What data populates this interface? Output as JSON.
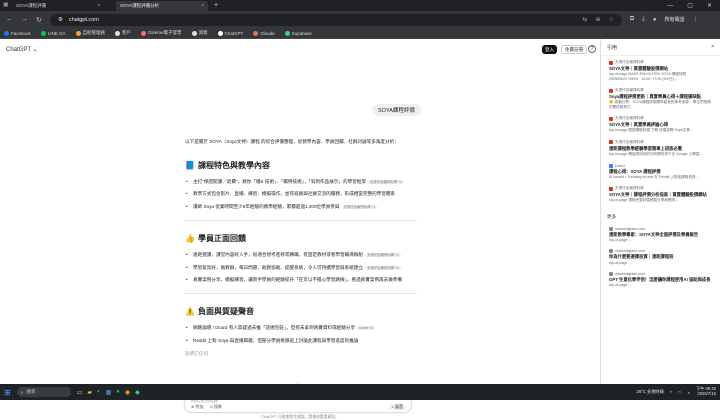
{
  "browser": {
    "tabs": [
      {
        "label": "SOYA課程評價"
      },
      {
        "label": "SOYA課程評價分析"
      }
    ],
    "url": "chatgpt.com",
    "account_label": "所有電話",
    "bookmarks": [
      "Facebook",
      "LINE OA",
      "自助管理員",
      "客戶",
      "Giveme電子發票",
      "測資",
      "ChatGPT",
      "Claude",
      "Supabase"
    ],
    "bookmark_colors": [
      "#1877f2",
      "#06c755",
      "#f5a623",
      "#e0e0e0",
      "#ff6b6b",
      "#e0e0e0",
      "#ffffff",
      "#d97757",
      "#3ecf8e"
    ]
  },
  "header": {
    "title": "ChatGPT ⌄",
    "login_label": "登入",
    "signup_label": "免費註冊",
    "help_icon": "?"
  },
  "user_message": "SOYA課程評價",
  "answer": {
    "intro": "以下是關於 SOYA（Soya文神）課程 的綜合評價整理，從教學內容、學員回饋、社群討論等多角度分析：",
    "sections": [
      {
        "icon": "📘",
        "title": "課程特色與教學內容",
        "items": [
          {
            "text": "主打\"保證開課／退費\"，教你「穩K 技術」、「獨特技術」，「寫到作品展示」的學習框架",
            "src": "天書仔店報資料庫 +1"
          },
          {
            "text": "教學方式包含影片、直播、練習、模擬操作，並有班群與社群交流的服務，形成相當完整的學習體系",
            "src": ""
          },
          {
            "text": "講師 Soya 從業時間至少6年經驗的教學經驗，累積超過1,200位學員參與",
            "src": "天書仔店報資料庫 +1"
          }
        ]
      },
      {
        "icon": "👍",
        "title": "學員正面回饋",
        "items": [
          {
            "text": "遠距授課，課堂內容好入手，很適合想考進修或轉職，有固定教材或者學習輔導群組",
            "src": "天書仔店報資料庫 +1"
          },
          {
            "text": "學習氣氛好，助教群，每日問題、助教協助、提醒系統，令人可持續學習與系統建立",
            "src": "天書仔店報資料庫 +1"
          },
          {
            "text": "真實案例分享、模擬練習，讓新手學員的經驗提升「在可以不擔心學習路線」，看過真實案例再去做準備",
            "src": ""
          }
        ]
      },
      {
        "icon": "⚠️",
        "title": "負面與質疑聲音",
        "items": [
          {
            "text": "網路論壇 / Dcard 有人質疑過去推「話術包裝」，但有未拿到真實資料或經驗分享",
            "src": "Dcard +3"
          },
          {
            "text": "Reddit 上對 Soya 與直播興趣，但部分學員要跟班上討論此課程與學習進度的推論",
            "src": ""
          }
        ]
      }
    ],
    "trailing_fade": "說明它任何"
  },
  "composer": {
    "placeholder": "詢問任何問題",
    "attach_label": "附加",
    "search_label": "搜尋",
    "voice_label": "語音"
  },
  "disclaimer": "ChatGPT 可能會發生錯誤。請查核重要資訊。",
  "sidebar": {
    "title": "引用",
    "citations": [
      {
        "pub": "天書仔店報資料庫",
        "title": "SOYA文神｜買賣體驗股價網站",
        "desc": "top-of-page MASS ENLIGHTEN SOYA 課程評價 2025/05/24~05/25 · 10:00~17:00 (9H/日)..."
      },
      {
        "pub": "天書仔店報資料庫",
        "title": "Soya課程評價更新｜真實學員心得＋課程優缺點",
        "desc": "🙂 感謝分享！SOYA課程評價標準給我的參考來源... 學生們長期的堅持與努力..."
      },
      {
        "pub": "天書仔店報資料庫",
        "title": "SOYA文神｜真實學員評論心得",
        "desc": "top-of-page 閱讀課程評價 了解 評價真實 Soya文神 ..."
      },
      {
        "pub": "天書仔店報資料庫",
        "title": "遠距課程教學經驗學習簡單上班族必看",
        "desc": "top-of-page 確認資訊你的在時間安排下去 Google 上學習..."
      },
      {
        "pub": "Dcard",
        "title": "課程心得：SOYA 課程評價",
        "desc": "Al forums • Trending forums 在 Reddit 上對各課程資訊..."
      },
      {
        "pub": "天書仔店報資料庫",
        "title": "SOYA文神｜課程評價分析指南｜買賣體驗股價網站",
        "desc": "top-of-page 課程完整評價經驗分享和實際..."
      }
    ],
    "more_label": "更多",
    "more_citations": [
      {
        "pub": "masserlighten.com",
        "title": "遠距教學專家：SOYA文神全面評價及學員報告",
        "desc": "top-of-page ..."
      },
      {
        "pub": "masserlighten.com",
        "title": "你為什麼要選擇投資｜遠距課程班",
        "desc": "top-of-page ..."
      },
      {
        "pub": "masserlighten.com",
        "title": "GPT 生意化學伴侶！怎麼讓你課程使用AI 協助與成長",
        "desc": "top-of-page ..."
      }
    ]
  },
  "taskbar": {
    "search_placeholder": "搜尋",
    "weather": "28°C 多雲時晴",
    "time": "下午 08:42",
    "date": "2025/7/15"
  }
}
